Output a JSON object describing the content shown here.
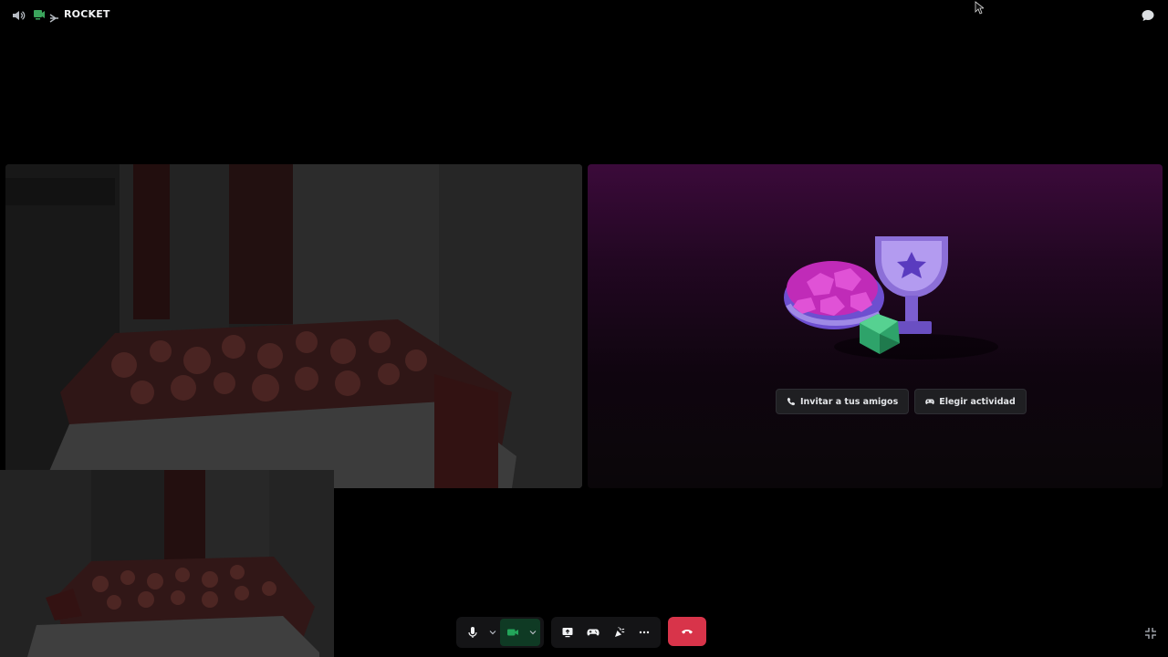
{
  "topbar": {
    "channel_name": "ROCKET",
    "icons": {
      "speaker": "speaker-icon",
      "channel": "voice-channel-icon",
      "chat": "chat-bubble-icon"
    }
  },
  "activity": {
    "invite_label": "Invitar a tus amigos",
    "choose_label": "Elegir actividad",
    "icons": {
      "invite": "add-friend-icon",
      "choose": "gamepad-icon"
    }
  },
  "controls": {
    "icons": [
      "microphone-icon",
      "camera-icon",
      "screen-share-icon",
      "activity-icon",
      "soundboard-icon",
      "more-icon",
      "hangup-icon"
    ]
  },
  "colors": {
    "accent_green": "#23a55a",
    "hangup_red": "#d8344a",
    "activity_purple": "#3b0a3a"
  }
}
